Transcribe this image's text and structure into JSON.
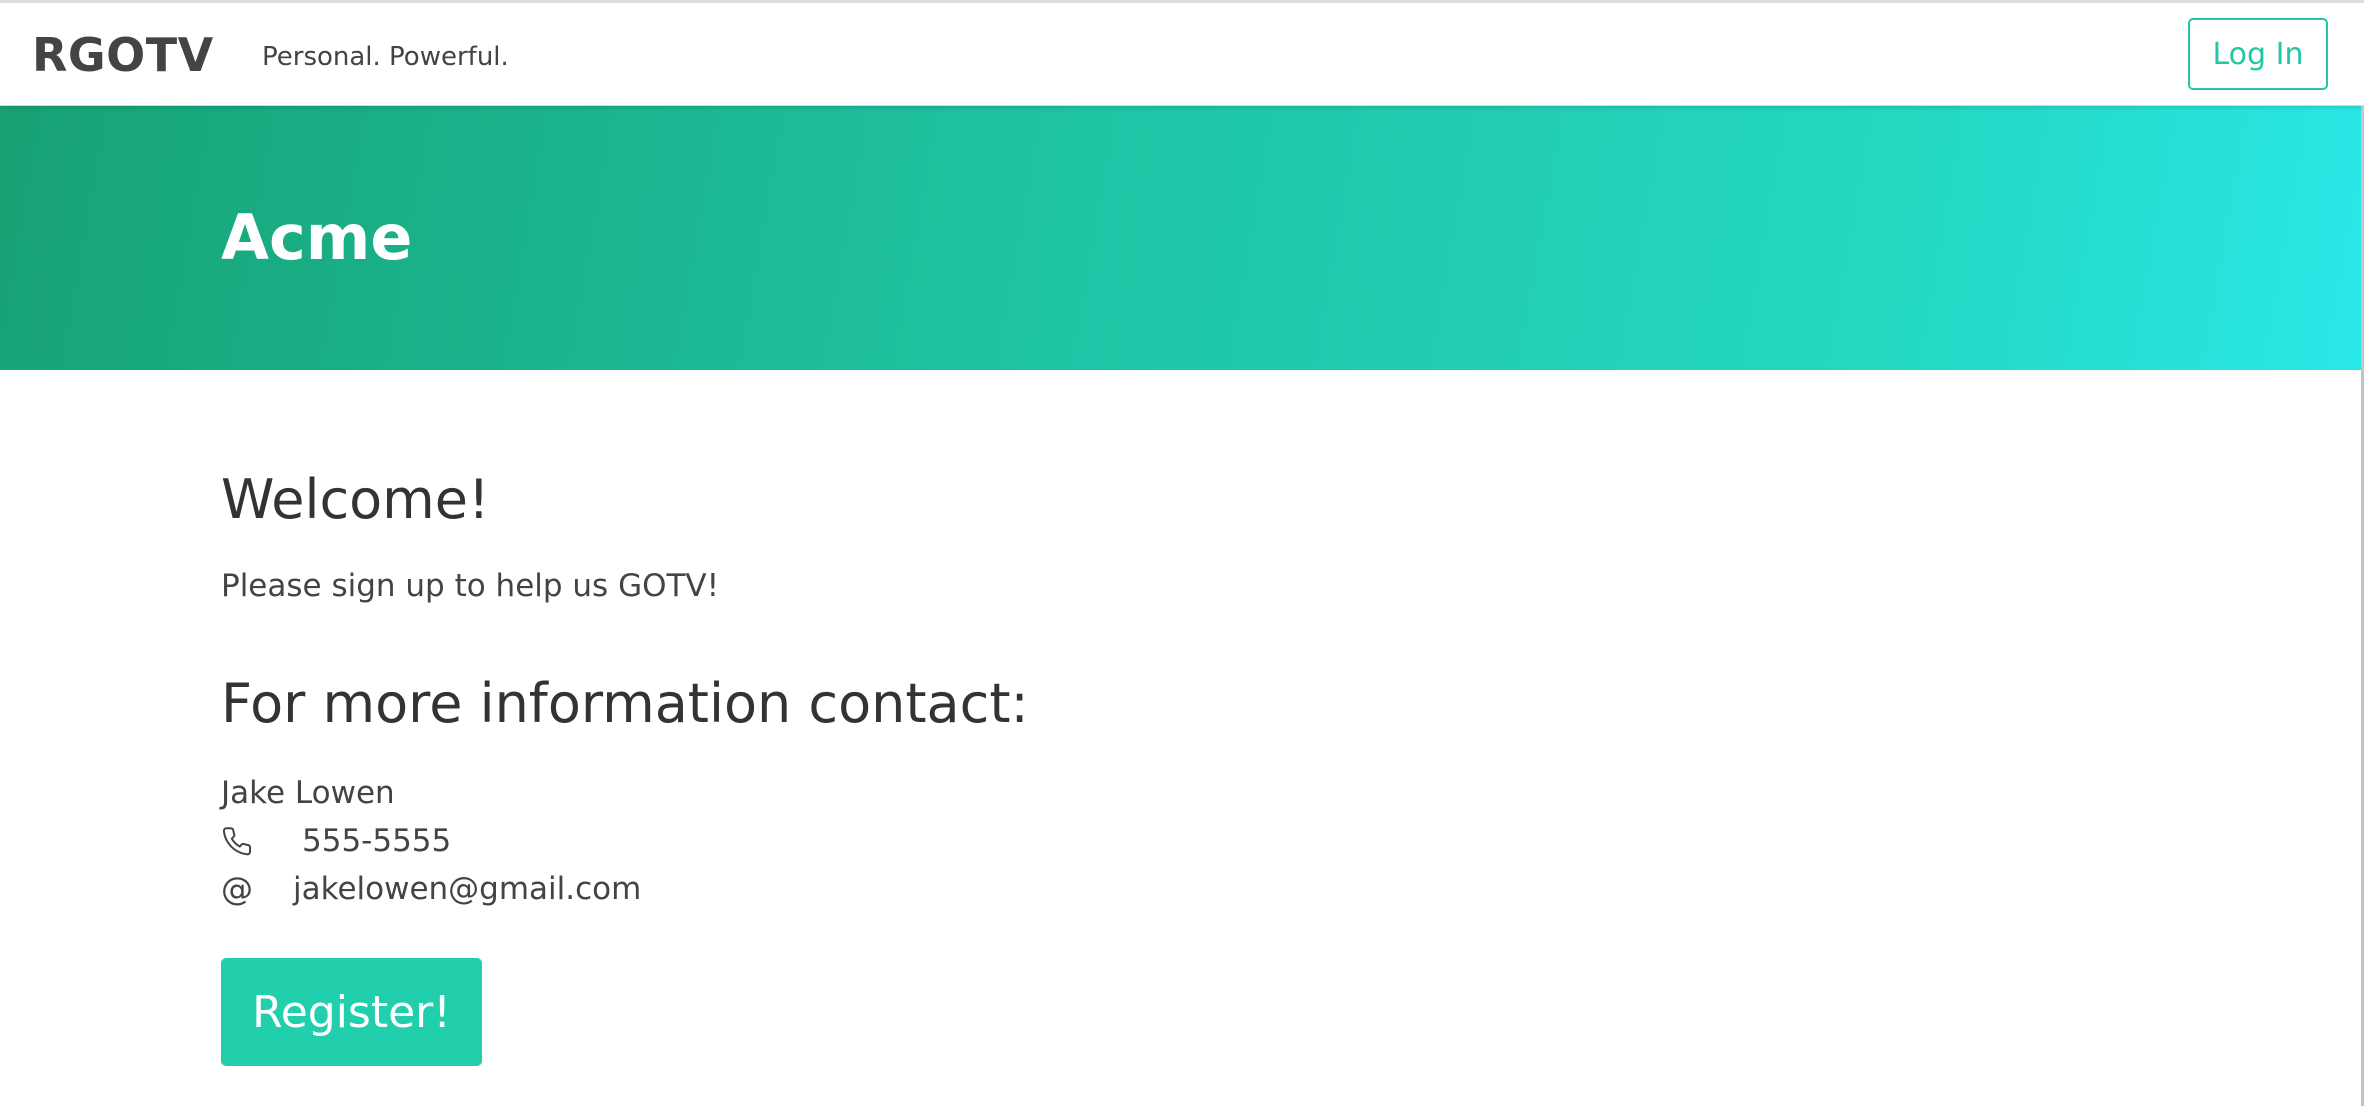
{
  "header": {
    "brand": "RGOTV",
    "tagline": "Personal. Powerful.",
    "login_label": "Log In"
  },
  "hero": {
    "title": "Acme"
  },
  "main": {
    "welcome_heading": "Welcome!",
    "intro_text": "Please sign up to help us GOTV!",
    "contact_heading": "For more information contact:",
    "contact": {
      "name": "Jake Lowen",
      "phone": "555-5555",
      "email": "jakelowen@gmail.com"
    },
    "register_label": "Register!"
  },
  "icons": {
    "phone": "phone-icon",
    "email": "at-sign-icon"
  },
  "colors": {
    "accent": "#22cfad",
    "hero_start": "#17a275",
    "hero_end": "#29e8e8",
    "text": "#3a3a3a"
  }
}
